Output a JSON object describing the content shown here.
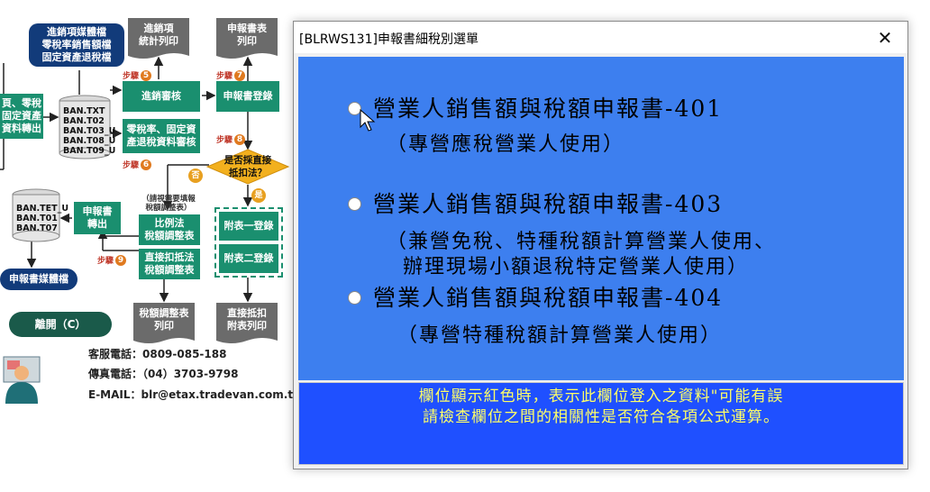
{
  "flowchart": {
    "box_media_files": "進銷項媒體檔\n零稅率銷售額檔\n固定資產退稅檔",
    "doc_stat_print": "進銷項\n統計列印",
    "doc_declaration_print": "申報書表\n列印",
    "box_left_transfer": "頁、零稅\n固定資產\n資料轉出",
    "files_top": "BAN.TXT\nBAN.T02\nBAN.T03_U\nBAN.T08_U\nBAN.T09_U",
    "box_audit": "進銷審核",
    "box_declaration_register": "申報書登錄",
    "box_zero_tax_audit": "零稅率、固定資\n產退稅資料審核",
    "decision": "是否採直接\n抵扣法？",
    "yes_label": "是",
    "no_label": "否",
    "note_adjust": "（請視需要填報\n稅額調整表）",
    "box_proportional": "比例法\n稅額調整表",
    "box_direct": "直接扣抵法\n稅額調整表",
    "box_appendix1": "附表一登錄",
    "box_appendix2": "附表二登錄",
    "files_bottom": "BAN.TET_U\nBAN.T01\nBAN.T07",
    "box_declaration_export": "申報書\n轉出",
    "box_declaration_media": "申報書媒體檔",
    "doc_adjust_print": "稅額調整表\n列印",
    "doc_direct_print": "直接抵扣\n附表列印",
    "exit_button": "離開（C）",
    "steps": [
      {
        "label": "步驟",
        "num": "5"
      },
      {
        "label": "步驟",
        "num": "6"
      },
      {
        "label": "步驟",
        "num": "7"
      },
      {
        "label": "步驟",
        "num": "8"
      },
      {
        "label": "步驟",
        "num": "9"
      }
    ],
    "contact": {
      "phone": "客服電話：0809-085-188",
      "fax": "傳真電話：（04）3703-9798",
      "email": "E-MAIL：blr@etax.tradevan.com.tw"
    }
  },
  "dialog": {
    "title": "[BLRWS131]申報書細稅別選單",
    "close_glyph": "✕",
    "options": [
      {
        "label": "營業人銷售額與稅額申報書-401",
        "desc": "（專營應稅營業人使用）"
      },
      {
        "label": "營業人銷售額與稅額申報書-403",
        "desc": "（兼營免稅、特種稅額計算營業人使用、\n  辦理現場小額退稅特定營業人使用）"
      },
      {
        "label": "營業人銷售額與稅額申報書-404",
        "desc": "（專營特種稅額計算營業人使用）"
      }
    ],
    "message": "欄位顯示紅色時，表示此欄位登入之資料\"可能有誤\n請檢查欄位之間的相關性是否符合各項公式運算。"
  },
  "colors": {
    "panel": "#3d7fef",
    "message_bg": "#1f50ff",
    "message_text": "#ffff66",
    "flow_teal": "#1a8f6f",
    "flow_navy": "#123b7a",
    "decision": "#f2b01e"
  },
  "icons": {
    "close": "close-icon",
    "cursor": "mouse-pointer-icon",
    "avatar": "support-agent-icon"
  }
}
